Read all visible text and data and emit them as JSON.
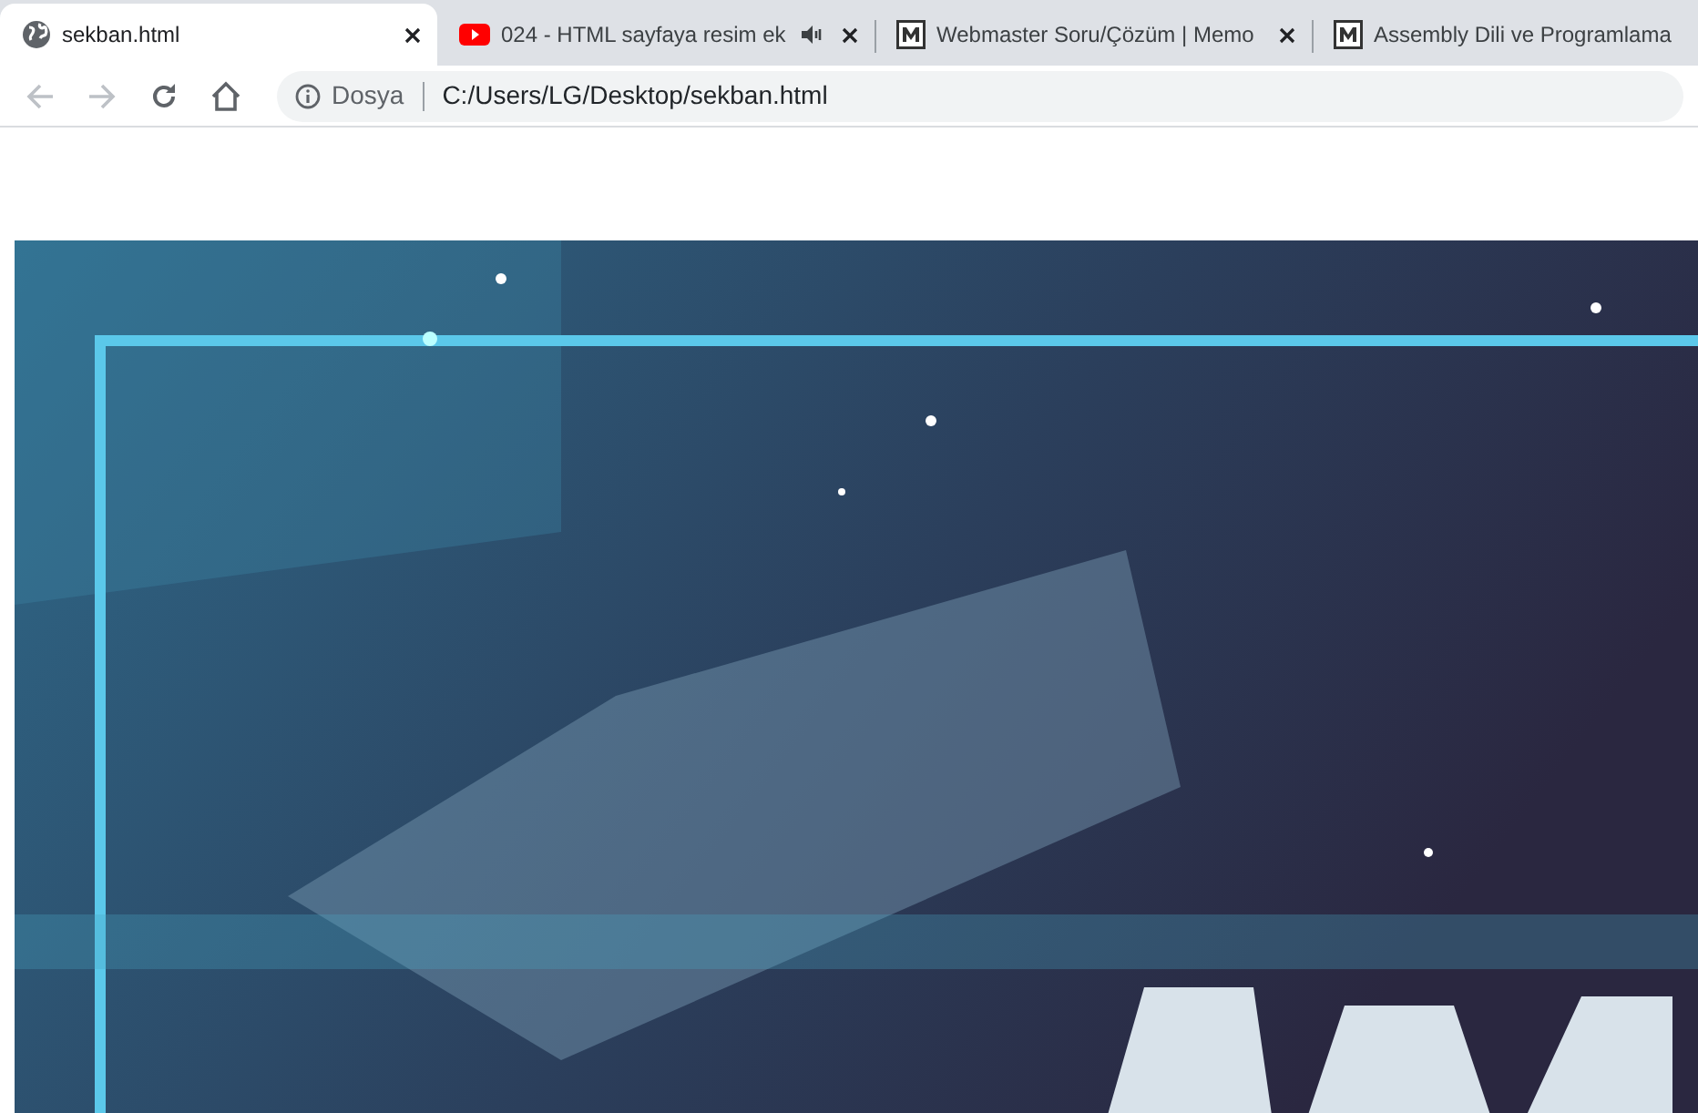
{
  "tabs": [
    {
      "kind": "globe",
      "title": "sekban.html",
      "selected": true,
      "audio": false,
      "closable": true
    },
    {
      "kind": "video",
      "title": "024 - HTML sayfaya resim ek",
      "selected": false,
      "audio": true,
      "closable": true
    },
    {
      "kind": "letter",
      "title": "Webmaster Soru/Çözüm | Memo",
      "selected": false,
      "audio": false,
      "closable": true
    },
    {
      "kind": "letter",
      "title": "Assembly Dili ve Programlama",
      "selected": false,
      "audio": false,
      "closable": false
    }
  ],
  "toolbar": {
    "back_disabled": true,
    "forward_disabled": true,
    "scheme_label": "Dosya",
    "url": "C:/Users/LG/Desktop/sekban.html"
  }
}
